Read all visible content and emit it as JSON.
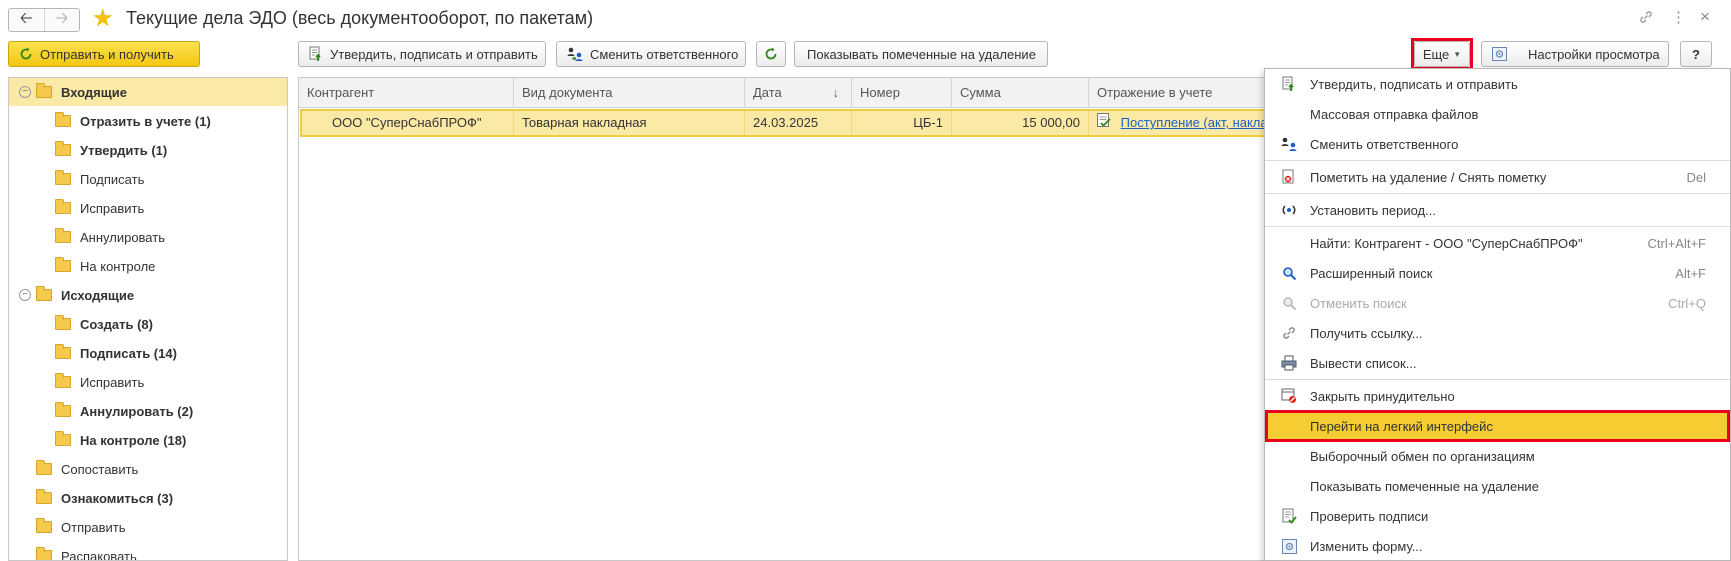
{
  "window": {
    "title": "Текущие дела ЭДО (весь документооборот, по пакетам)"
  },
  "toolbar": {
    "send_receive": "Отправить и получить",
    "approve_sign_send": "Утвердить, подписать и отправить",
    "change_responsible": "Сменить ответственного",
    "show_deleted": "Показывать помеченные на удаление",
    "more": "Еще",
    "view_settings": "Настройки просмотра",
    "help": "?"
  },
  "tree": [
    {
      "label": "Входящие",
      "level": 0,
      "bold": true,
      "selected": true,
      "collapsible": true
    },
    {
      "label": "Отразить в учете (1)",
      "level": 1,
      "bold": true
    },
    {
      "label": "Утвердить (1)",
      "level": 1,
      "bold": true
    },
    {
      "label": "Подписать",
      "level": 1,
      "bold": false
    },
    {
      "label": "Исправить",
      "level": 1,
      "bold": false
    },
    {
      "label": "Аннулировать",
      "level": 1,
      "bold": false
    },
    {
      "label": "На контроле",
      "level": 1,
      "bold": false
    },
    {
      "label": "Исходящие",
      "level": 0,
      "bold": true,
      "collapsible": true
    },
    {
      "label": "Создать (8)",
      "level": 1,
      "bold": true
    },
    {
      "label": "Подписать (14)",
      "level": 1,
      "bold": true
    },
    {
      "label": "Исправить",
      "level": 1,
      "bold": false
    },
    {
      "label": "Аннулировать (2)",
      "level": 1,
      "bold": true
    },
    {
      "label": "На контроле (18)",
      "level": 1,
      "bold": true
    },
    {
      "label": "Сопоставить",
      "level": 0,
      "bold": false
    },
    {
      "label": "Ознакомиться (3)",
      "level": 0,
      "bold": true
    },
    {
      "label": "Отправить",
      "level": 0,
      "bold": false
    },
    {
      "label": "Распаковать",
      "level": 0,
      "bold": false
    }
  ],
  "table": {
    "columns": [
      "Контрагент",
      "Вид документа",
      "Дата",
      "Номер",
      "Сумма",
      "Отражение в учете"
    ],
    "rows": [
      {
        "counterparty": "ООО \"СуперСнабПРОФ\"",
        "doc_type": "Товарная накладная",
        "date": "24.03.2025",
        "number": "ЦБ-1",
        "sum": "15 000,00",
        "accounting": "Поступление (акт, накладная"
      }
    ]
  },
  "menu": [
    {
      "label": "Утвердить, подписать и отправить",
      "icon": "approve-send-icon",
      "key": ""
    },
    {
      "label": "Массовая отправка файлов",
      "icon": "",
      "key": ""
    },
    {
      "label": "Сменить ответственного",
      "icon": "change-responsible-icon",
      "key": ""
    },
    {
      "sep": true
    },
    {
      "label": "Пометить на удаление / Снять пометку",
      "icon": "mark-delete-icon",
      "key": "Del"
    },
    {
      "sep": true
    },
    {
      "label": "Установить период...",
      "icon": "set-period-icon",
      "key": ""
    },
    {
      "sep": true
    },
    {
      "label": "Найти: Контрагент - ООО \"СуперСнабПРОФ\"",
      "icon": "",
      "key": "Ctrl+Alt+F"
    },
    {
      "label": "Расширенный поиск",
      "icon": "advanced-search-icon",
      "key": "Alt+F"
    },
    {
      "label": "Отменить поиск",
      "icon": "cancel-search-icon",
      "key": "Ctrl+Q",
      "disabled": true
    },
    {
      "label": "Получить ссылку...",
      "icon": "link-icon",
      "key": ""
    },
    {
      "label": "Вывести список...",
      "icon": "print-list-icon",
      "key": ""
    },
    {
      "sep": true
    },
    {
      "label": "Закрыть принудительно",
      "icon": "force-close-icon",
      "key": ""
    },
    {
      "label": "Перейти на легкий интерфейс",
      "icon": "",
      "key": "",
      "highlighted": true
    },
    {
      "label": "Выборочный обмен по организациям",
      "icon": "",
      "key": ""
    },
    {
      "label": "Показывать помеченные на удаление",
      "icon": "",
      "key": ""
    },
    {
      "label": "Проверить подписи",
      "icon": "check-signatures-icon",
      "key": ""
    },
    {
      "label": "Изменить форму...",
      "icon": "change-form-icon",
      "key": ""
    }
  ],
  "colors": {
    "accent_yellow": "#f5cc31",
    "selection": "#fbe9a6",
    "highlight_frame": "#e8001c",
    "link": "#1d5ec6"
  }
}
